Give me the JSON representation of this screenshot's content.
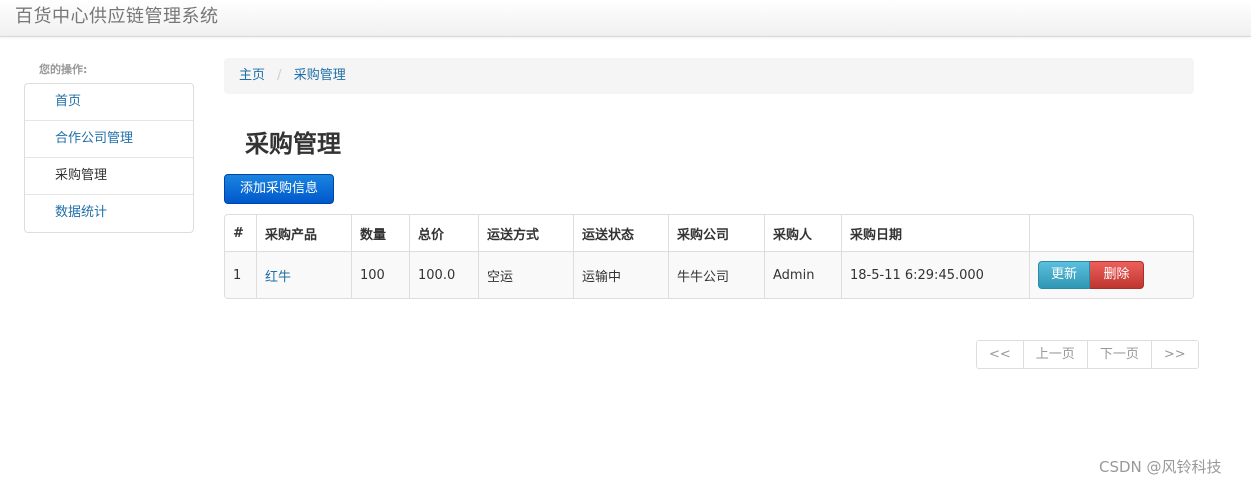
{
  "navbar": {
    "brand": "百货中心供应链管理系统"
  },
  "sidebar": {
    "header": "您的操作:",
    "items": [
      {
        "label": "首页"
      },
      {
        "label": "合作公司管理"
      },
      {
        "label": "采购管理"
      },
      {
        "label": "数据统计"
      }
    ]
  },
  "breadcrumb": {
    "home": "主页",
    "separator": "/",
    "current": "采购管理"
  },
  "page": {
    "title": "采购管理",
    "add_button": "添加采购信息"
  },
  "table": {
    "headers": [
      "#",
      "采购产品",
      "数量",
      "总价",
      "运送方式",
      "运送状态",
      "采购公司",
      "采购人",
      "采购日期",
      ""
    ],
    "rows": [
      {
        "index": "1",
        "product": "红牛",
        "quantity": "100",
        "total": "100.0",
        "shipping_method": "空运",
        "shipping_status": "运输中",
        "company": "牛牛公司",
        "buyer": "Admin",
        "date": "18-5-11 6:29:45.000",
        "update_label": "更新",
        "delete_label": "删除"
      }
    ]
  },
  "pagination": {
    "first": "<<",
    "prev": "上一页",
    "next": "下一页",
    "last": ">>"
  },
  "watermark": "CSDN @风铃科技",
  "colors": {
    "primary": "#0058cc",
    "info": "#2f96b4",
    "danger": "#bd362f",
    "link": "#1f6fa8"
  }
}
